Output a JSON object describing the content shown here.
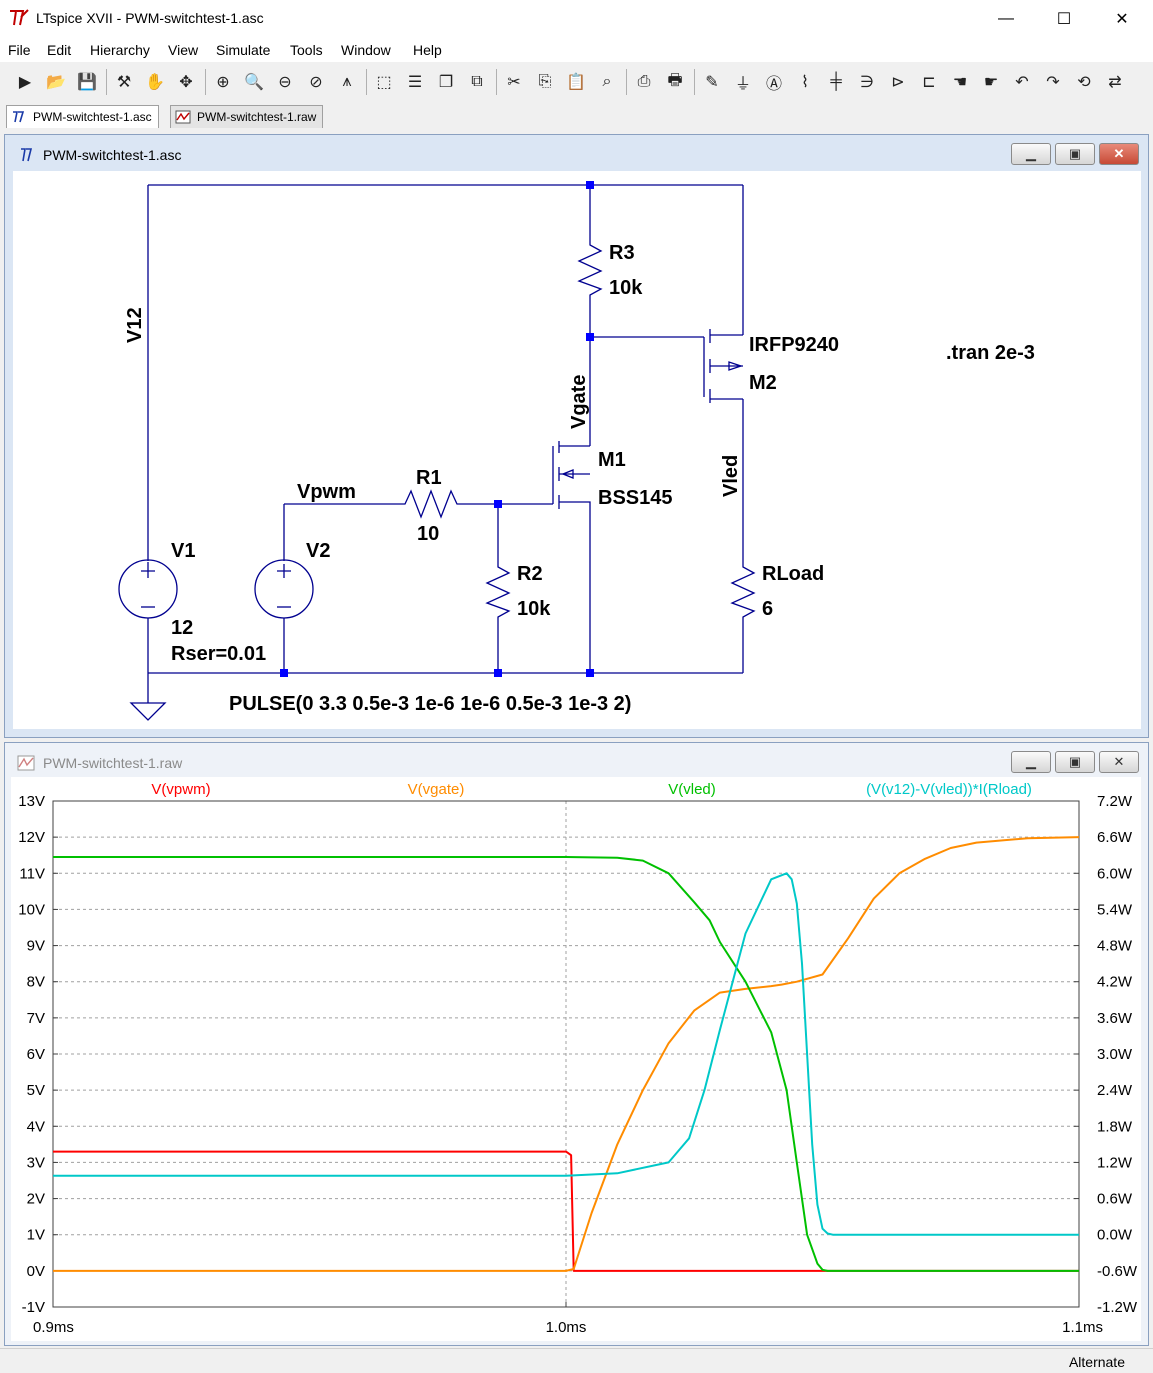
{
  "window": {
    "title": "LTspice XVII - PWM-switchtest-1.asc",
    "minimize_glyph": "—",
    "maximize_glyph": "☐",
    "close_glyph": "✕"
  },
  "menu": [
    "File",
    "Edit",
    "Hierarchy",
    "View",
    "Simulate",
    "Tools",
    "Window",
    "Help"
  ],
  "toolbar": {
    "icons": [
      "run-icon",
      "open-icon",
      "save-icon",
      "control-panel-icon",
      "halt-icon",
      "pan-icon",
      "zoom-in-icon",
      "zoom-area-icon",
      "zoom-out-icon",
      "zoom-cancel-icon",
      "autorange-icon",
      "zoom-full-icon",
      "tile-icon",
      "cascade-icon",
      "close-all-icon",
      "cut-icon",
      "copy-icon",
      "paste-icon",
      "find-icon",
      "print-preview-icon",
      "print-icon",
      "wire-icon",
      "ground-icon",
      "label-icon",
      "resistor-icon",
      "capacitor-icon",
      "inductor-icon",
      "diode-icon",
      "component-icon",
      "move-icon",
      "drag-icon",
      "undo-icon",
      "redo-icon",
      "rotate-icon",
      "mirror-icon"
    ]
  },
  "tabs": [
    {
      "label": "PWM-switchtest-1.asc",
      "icon": "schematic-icon",
      "active": true
    },
    {
      "label": "PWM-switchtest-1.raw",
      "icon": "waveform-icon",
      "active": false
    }
  ],
  "schematic_window": {
    "title": "PWM-switchtest-1.asc",
    "labels": {
      "v12": "V12",
      "r3_name": "R3",
      "r3_value": "10k",
      "m2_model": "IRFP9240",
      "m2_name": "M2",
      "tran": ".tran 2e-3",
      "vgate": "Vgate",
      "m1_name": "M1",
      "m1_model": "BSS145",
      "vled": "Vled",
      "vpwm": "Vpwm",
      "r1_name": "R1",
      "r1_value": "10",
      "v1_name": "V1",
      "v2_name": "V2",
      "v1_value": "12",
      "v1_rser": "Rser=0.01",
      "r2_name": "R2",
      "r2_value": "10k",
      "rload_name": "RLoad",
      "rload_value": "6",
      "pulse": "PULSE(0 3.3 0.5e-3 1e-6 1e-6 0.5e-3 1e-3 2)"
    },
    "colors": {
      "wire": "#00008f",
      "junction": "#0000ff",
      "text": "#000000"
    }
  },
  "waveform_window": {
    "title": "PWM-switchtest-1.raw"
  },
  "chart_data": {
    "type": "line",
    "x_range": [
      0.9,
      1.1
    ],
    "x_unit": "ms",
    "x_ticks": [
      "0.9ms",
      "1.0ms",
      "1.1ms"
    ],
    "x_tick_values": [
      0.9,
      1.0,
      1.1
    ],
    "y_left_range": [
      -1,
      13
    ],
    "y_left_ticks": [
      "13V",
      "12V",
      "11V",
      "10V",
      "9V",
      "8V",
      "7V",
      "6V",
      "5V",
      "4V",
      "3V",
      "2V",
      "1V",
      "0V",
      "-1V"
    ],
    "y_left_tick_values": [
      13,
      12,
      11,
      10,
      9,
      8,
      7,
      6,
      5,
      4,
      3,
      2,
      1,
      0,
      -1
    ],
    "y_right_range": [
      -1.2,
      7.2
    ],
    "y_right_ticks": [
      "7.2W",
      "6.6W",
      "6.0W",
      "5.4W",
      "4.8W",
      "4.2W",
      "3.6W",
      "3.0W",
      "2.4W",
      "1.8W",
      "1.2W",
      "0.6W",
      "0.0W",
      "-0.6W",
      "-1.2W"
    ],
    "y_right_tick_values": [
      7.2,
      6.6,
      6.0,
      5.4,
      4.8,
      4.2,
      3.6,
      3.0,
      2.4,
      1.8,
      1.2,
      0.6,
      0.0,
      -0.6,
      -1.2
    ],
    "grid": true,
    "cursor_x": 1.0,
    "series": [
      {
        "name": "V(vpwm)",
        "color": "#ff0000",
        "axis": "left",
        "x": [
          0.9,
          1.0,
          1.001,
          1.0015,
          1.1
        ],
        "y": [
          3.3,
          3.3,
          3.2,
          0.0,
          0.0
        ]
      },
      {
        "name": "V(vgate)",
        "color": "#ff8c00",
        "axis": "left",
        "x": [
          0.9,
          1.0,
          1.0015,
          1.005,
          1.01,
          1.015,
          1.02,
          1.025,
          1.03,
          1.035,
          1.04,
          1.042,
          1.045,
          1.05,
          1.055,
          1.06,
          1.065,
          1.07,
          1.075,
          1.08,
          1.09,
          1.1
        ],
        "y": [
          0.0,
          0.0,
          0.05,
          1.6,
          3.5,
          5.0,
          6.3,
          7.2,
          7.7,
          7.8,
          7.88,
          7.92,
          8.0,
          8.2,
          9.2,
          10.3,
          11.0,
          11.4,
          11.7,
          11.85,
          11.97,
          12.0
        ],
        "style": "solid"
      },
      {
        "name": "V(vled)",
        "color": "#00c000",
        "axis": "left",
        "x": [
          0.9,
          1.0,
          1.01,
          1.015,
          1.02,
          1.025,
          1.028,
          1.03,
          1.035,
          1.04,
          1.043,
          1.045,
          1.047,
          1.049,
          1.05,
          1.051,
          1.1
        ],
        "y": [
          11.45,
          11.45,
          11.43,
          11.35,
          11.0,
          10.2,
          9.7,
          9.1,
          8.0,
          6.6,
          5.0,
          3.0,
          1.0,
          0.2,
          0.03,
          0.0,
          0.0
        ]
      },
      {
        "name": "(V(v12)-V(vled))*I(Rload)",
        "color": "#00c8c8",
        "axis": "right",
        "x": [
          0.9,
          1.0,
          1.01,
          1.02,
          1.024,
          1.027,
          1.03,
          1.035,
          1.04,
          1.043,
          1.044,
          1.045,
          1.046,
          1.047,
          1.048,
          1.049,
          1.05,
          1.051,
          1.052,
          1.1
        ],
        "y": [
          0.98,
          0.98,
          1.02,
          1.2,
          1.6,
          2.4,
          3.4,
          5.0,
          5.9,
          6.0,
          5.9,
          5.5,
          4.5,
          3.0,
          1.5,
          0.5,
          0.1,
          0.02,
          0.0,
          0.0
        ]
      }
    ]
  },
  "status": {
    "text": "Alternate"
  }
}
